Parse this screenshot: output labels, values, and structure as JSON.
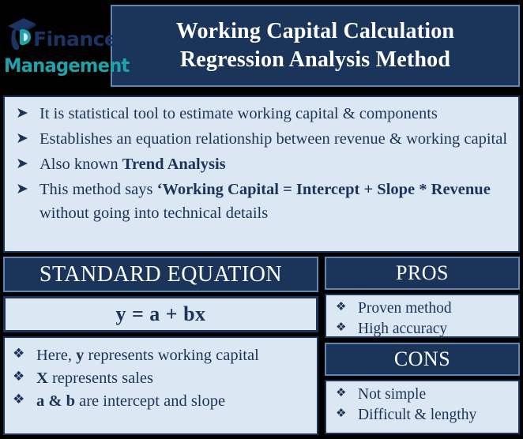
{
  "logo": {
    "icon": "graduation-cap-icon",
    "line1": "Finance",
    "line2": "Management",
    "navy": "#1c3461",
    "teal": "#1fa3ab"
  },
  "title": {
    "line1": "Working Capital Calculation",
    "line2": "Regression Analysis Method"
  },
  "intro": {
    "marker": "➤",
    "bullets": [
      {
        "parts": [
          {
            "text": "It is statistical tool to estimate working capital & components",
            "bold": false
          }
        ]
      },
      {
        "parts": [
          {
            "text": "Establishes an equation relationship between revenue & working capital",
            "bold": false
          }
        ]
      },
      {
        "parts": [
          {
            "text": "Also known ",
            "bold": false
          },
          {
            "text": "Trend Analysis",
            "bold": true
          }
        ]
      },
      {
        "parts": [
          {
            "text": "This method says ",
            "bold": false
          },
          {
            "text": "‘Working Capital = Intercept + Slope * Revenue",
            "bold": true
          },
          {
            "text": " without going into technical details",
            "bold": false
          }
        ]
      }
    ]
  },
  "standard_equation": {
    "header": "STANDARD EQUATION",
    "equation": "y = a + bx",
    "marker": "❖",
    "notes": [
      {
        "parts": [
          {
            "text": "Here, ",
            "bold": false
          },
          {
            "text": "y",
            "bold": true
          },
          {
            "text": " represents working capital",
            "bold": false
          }
        ]
      },
      {
        "parts": [
          {
            "text": "X",
            "bold": true
          },
          {
            "text": " represents sales",
            "bold": false
          }
        ]
      },
      {
        "parts": [
          {
            "text": "a & b",
            "bold": true
          },
          {
            "text": " are intercept and slope",
            "bold": false
          }
        ]
      }
    ]
  },
  "pros": {
    "header": "PROS",
    "marker": "❖",
    "items": [
      "Proven method",
      "High accuracy"
    ]
  },
  "cons": {
    "header": "CONS",
    "marker": "❖",
    "items": [
      "Not simple",
      "Difficult & lengthy"
    ]
  },
  "colors": {
    "navy": "#1b3459",
    "panel_blue": "#dce7f4",
    "border_light_blue": "#5f87b5",
    "background": "#000000"
  }
}
